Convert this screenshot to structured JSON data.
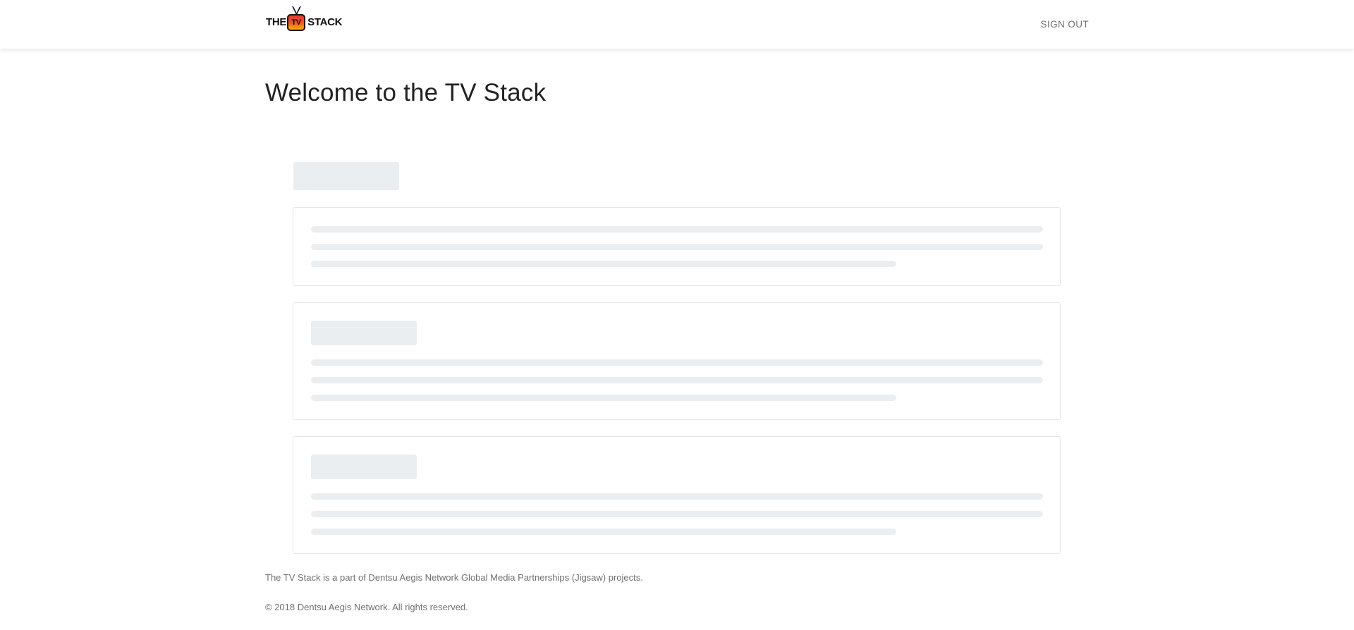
{
  "header": {
    "logo": {
      "part1": "THE",
      "part2": "TV",
      "part3": "STACK"
    },
    "signout_label": "SIGN OUT"
  },
  "main": {
    "title": "Welcome to the TV Stack",
    "loading_placeholders": {
      "cards": 3,
      "lines_per_card": 3
    }
  },
  "footer": {
    "line1": "The TV Stack is a part of Dentsu Aegis Network Global Media Partnerships (Jigsaw) projects.",
    "line2": "© 2018 Dentsu Aegis Network. All rights reserved."
  },
  "colors": {
    "skeleton": "#ebeef1",
    "card_border": "#e3e6ea",
    "muted_text": "#6f6f6f",
    "logo_red": "#e53935",
    "logo_yellow": "#ffb300"
  }
}
